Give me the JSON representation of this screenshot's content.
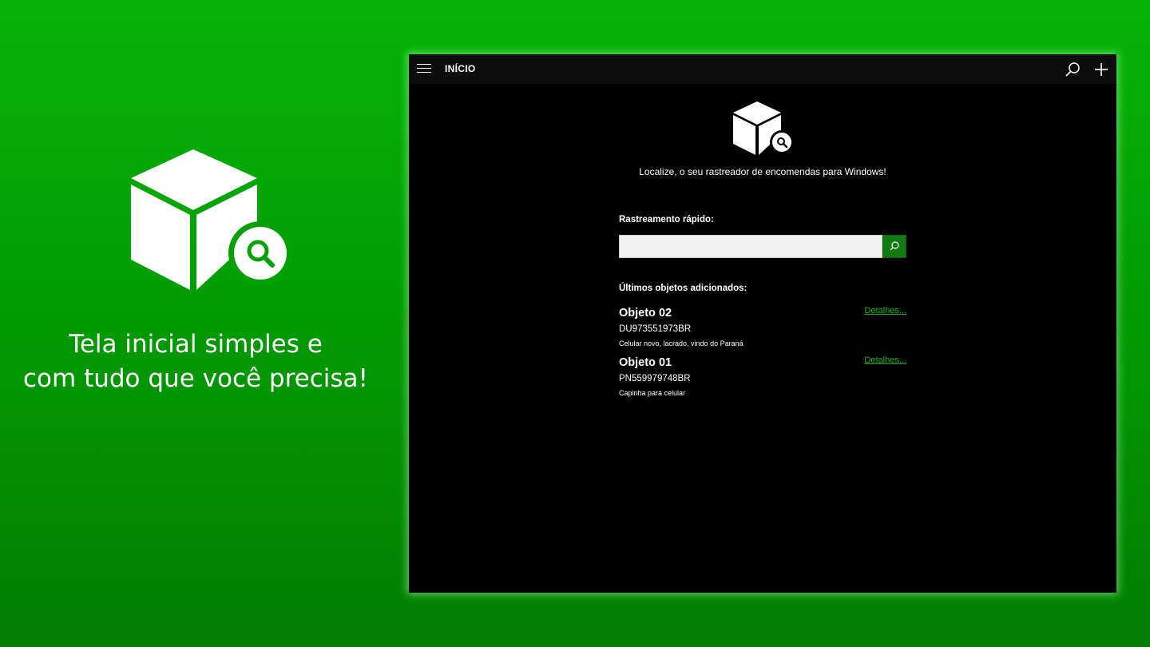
{
  "promo": {
    "line1": "Tela inicial simples e",
    "line2": "com tudo que você precisa!"
  },
  "app": {
    "title": "INÍCIO",
    "tagline": "Localize, o seu rastreador de encomendas para Windows!",
    "quick_track_label": "Rastreamento rápido:",
    "quick_track_value": "",
    "recent_label": "Últimos objetos adicionados:",
    "items": [
      {
        "name": "Objeto 02",
        "code": "DU973551973BR",
        "description": "Celular novo, lacrado, vindo do Paraná",
        "details_label": "Detalhes..."
      },
      {
        "name": "Objeto 01",
        "code": "PN559979748BR",
        "description": "Capinha para celular",
        "details_label": "Detalhes..."
      }
    ]
  },
  "icons": [
    "package-search-icon",
    "hamburger-menu-icon",
    "search-icon",
    "add-icon"
  ],
  "colors": {
    "background_top": "#05b505",
    "background_bottom": "#027f02",
    "window": "#000000",
    "titlebar": "#0d0d0d",
    "accent": "#117a11",
    "link": "#19b319"
  }
}
